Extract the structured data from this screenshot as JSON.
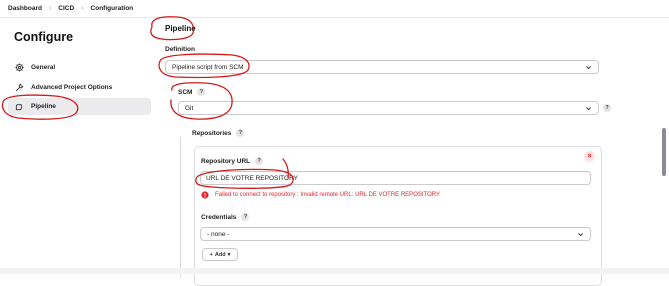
{
  "breadcrumb": {
    "items": [
      "Dashboard",
      "CICD",
      "Configuration"
    ]
  },
  "sidebar": {
    "title": "Configure",
    "items": [
      {
        "label": "General",
        "icon": "gear-icon"
      },
      {
        "label": "Advanced Project Options",
        "icon": "wrench-icon"
      },
      {
        "label": "Pipeline",
        "icon": "pipeline-icon",
        "active": true
      }
    ]
  },
  "main": {
    "section_title": "Pipeline",
    "definition": {
      "label": "Definition",
      "value": "Pipeline script from SCM"
    },
    "scm": {
      "label": "SCM",
      "help": "?",
      "value": "Git"
    },
    "repositories": {
      "label": "Repositories",
      "help": "?",
      "repo_url_label": "Repository URL",
      "repo_url_help": "?",
      "repo_url_value": "URL DE VOTRE REPOSITORY",
      "error": "Failed to connect to repository : Invalid remote URL: URL DE VOTRE REPOSITORY",
      "credentials_label": "Credentials",
      "credentials_help": "?",
      "credentials_value": "- none -",
      "add_label": "Add",
      "add_caret": "▾",
      "close_label": "×"
    }
  },
  "colors": {
    "error": "#e5262c",
    "annotation_red": "#d11a1a",
    "active_bg": "#ebebee"
  }
}
